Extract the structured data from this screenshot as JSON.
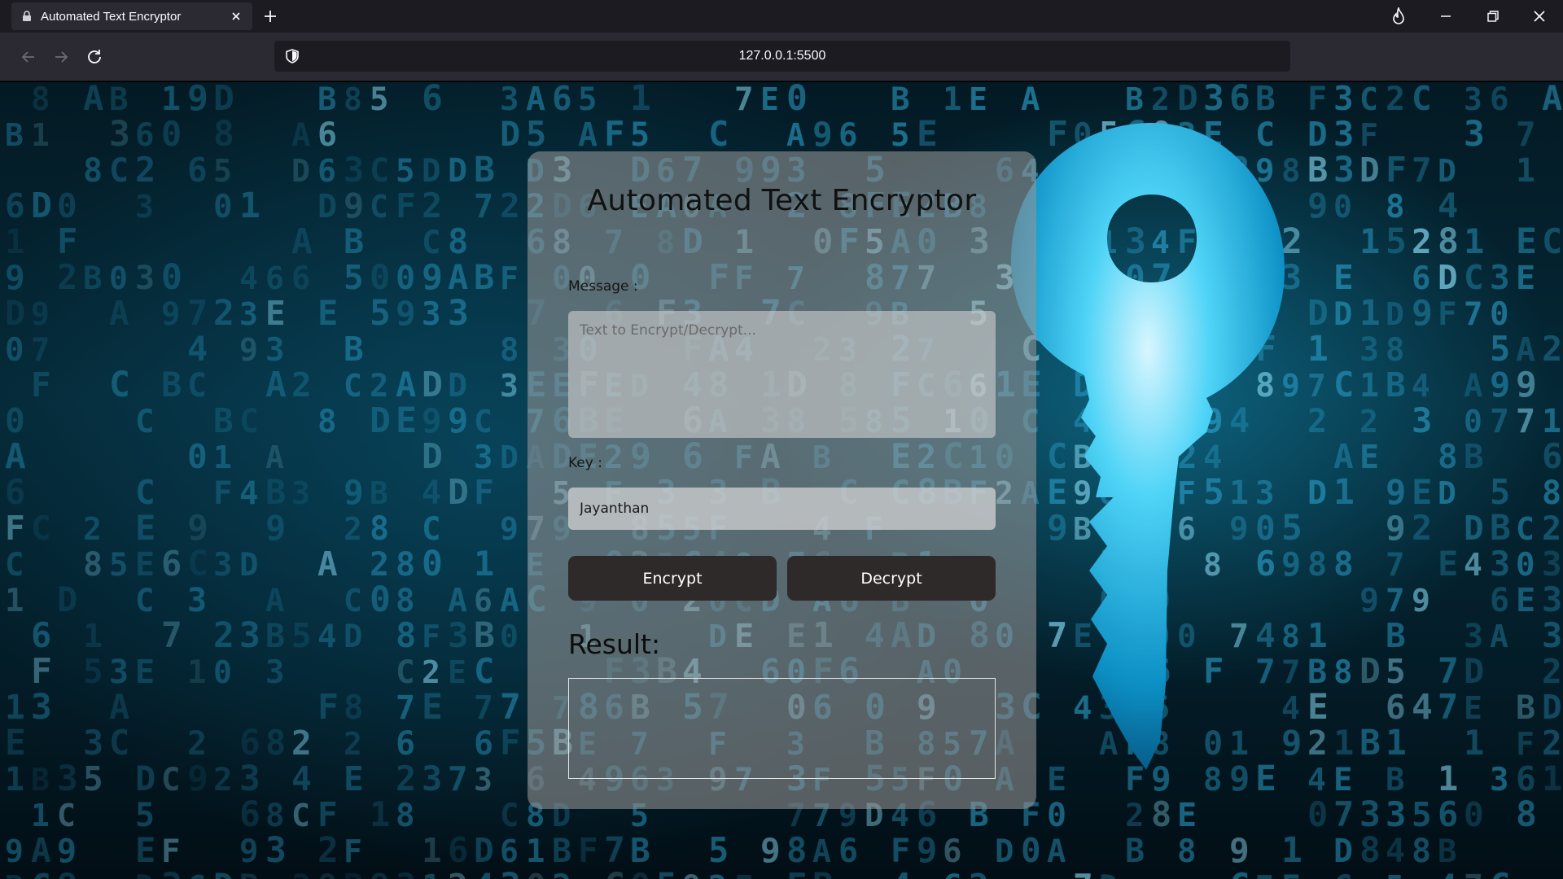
{
  "browser": {
    "tab_title": "Automated Text Encryptor",
    "url": "127.0.0.1:5500"
  },
  "page": {
    "title": "Automated Text Encryptor",
    "message_label": "Message :",
    "message_placeholder": "Text to Encrypt/Decrypt...",
    "message_value": "",
    "key_label": "Key :",
    "key_value": "Jayanthan",
    "encrypt_label": "Encrypt",
    "decrypt_label": "Decrypt",
    "result_label": "Result:",
    "result_value": ""
  },
  "colors": {
    "chrome_dark": "#1c1b22",
    "chrome_mid": "#2b2a33",
    "button_bg": "#2f2a2a",
    "accent_cyan": "#38c6ee"
  },
  "icons": {
    "favicon": "lock-icon",
    "tab_close": "close-icon",
    "new_tab": "plus-icon",
    "fire": "fire-icon",
    "minimize": "minimize-icon",
    "restore": "restore-icon",
    "close": "close-icon",
    "back": "back-arrow-icon",
    "forward": "forward-arrow-icon",
    "reload": "reload-icon",
    "shield": "shield-icon",
    "menu": "more-horizontal-icon"
  }
}
